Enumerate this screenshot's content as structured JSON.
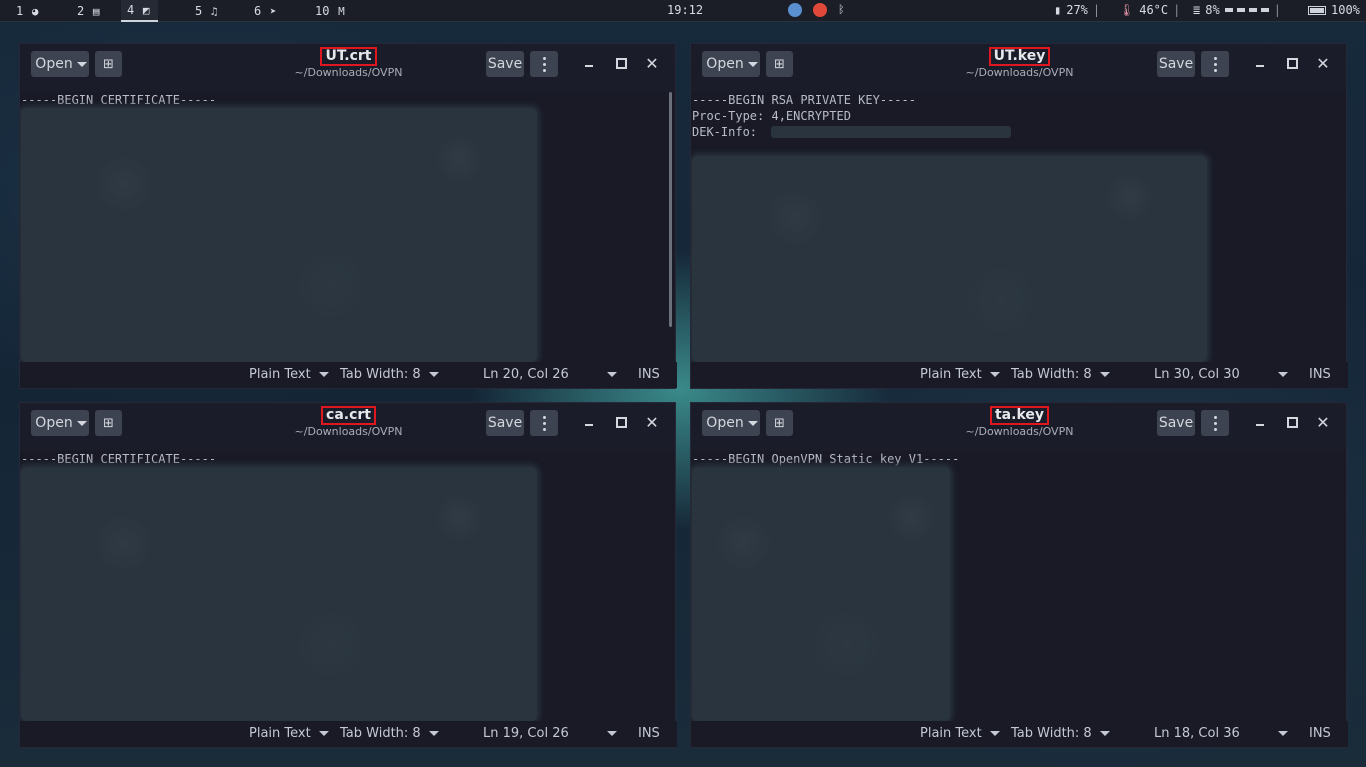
{
  "topbar": {
    "workspaces": [
      {
        "num": "1",
        "icon": "firefox-icon",
        "glyph": "◕"
      },
      {
        "num": "2",
        "icon": "document-icon",
        "glyph": "▤"
      },
      {
        "num": "4",
        "icon": "editor-icon",
        "glyph": "◩",
        "active": true
      },
      {
        "num": "5",
        "icon": "music-icon",
        "glyph": "♫"
      },
      {
        "num": "6",
        "icon": "telegram-icon",
        "glyph": "➤"
      },
      {
        "num": "10",
        "icon": "mail-icon",
        "glyph": "M"
      }
    ],
    "clock": "19:12",
    "cpu": "27%",
    "temperature": "46°C",
    "memory": "8%",
    "battery": "100%",
    "colors": {
      "tray_app_1": "#5a8fd0",
      "tray_app_2": "#e0483a"
    }
  },
  "windows": [
    {
      "title": "UT.crt",
      "path": "~/Downloads/OVPN",
      "open_label": "Open",
      "save_label": "Save",
      "lines": [
        "-----BEGIN CERTIFICATE-----"
      ],
      "language": "Plain Text",
      "tab_width": "Tab Width: 8",
      "position": "Ln 20, Col 26",
      "mode": "INS"
    },
    {
      "title": "UT.key",
      "path": "~/Downloads/OVPN",
      "open_label": "Open",
      "save_label": "Save",
      "lines": [
        "-----BEGIN RSA PRIVATE KEY-----",
        "Proc-Type: 4,ENCRYPTED",
        "DEK-Info: "
      ],
      "language": "Plain Text",
      "tab_width": "Tab Width: 8",
      "position": "Ln 30, Col 30",
      "mode": "INS"
    },
    {
      "title": "ca.crt",
      "path": "~/Downloads/OVPN",
      "open_label": "Open",
      "save_label": "Save",
      "lines": [
        "-----BEGIN CERTIFICATE-----"
      ],
      "language": "Plain Text",
      "tab_width": "Tab Width: 8",
      "position": "Ln 19, Col 26",
      "mode": "INS"
    },
    {
      "title": "ta.key",
      "path": "~/Downloads/OVPN",
      "open_label": "Open",
      "save_label": "Save",
      "lines": [
        "-----BEGIN OpenVPN Static key V1-----"
      ],
      "language": "Plain Text",
      "tab_width": "Tab Width: 8",
      "position": "Ln 18, Col 36",
      "mode": "INS"
    }
  ]
}
